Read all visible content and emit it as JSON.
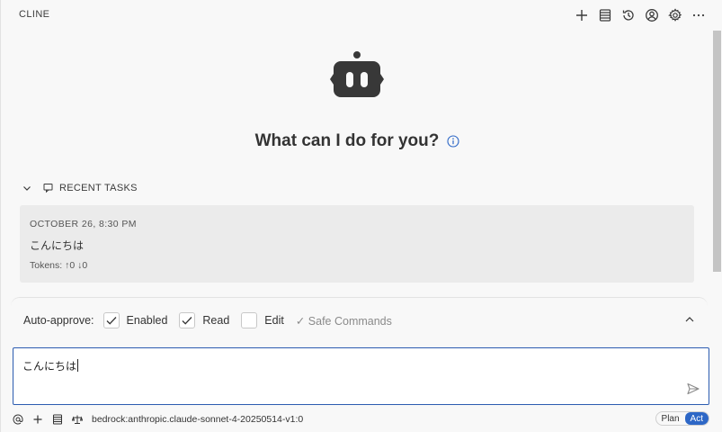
{
  "header": {
    "title": "CLINE",
    "icons": [
      "plus-icon",
      "server-icon",
      "history-icon",
      "account-icon",
      "gear-icon",
      "more-icon"
    ]
  },
  "hero": {
    "title": "What can I do for you?"
  },
  "recent_tasks": {
    "header": "RECENT TASKS",
    "items": [
      {
        "date": "OCTOBER 26, 8:30 PM",
        "text": "こんにちは",
        "tokens": "Tokens: ↑0 ↓0"
      }
    ]
  },
  "auto_approve": {
    "label": "Auto-approve:",
    "options": [
      {
        "label": "Enabled",
        "checked": true
      },
      {
        "label": "Read",
        "checked": true
      },
      {
        "label": "Edit",
        "checked": false
      }
    ],
    "safe_commands": "✓ Safe Commands"
  },
  "chat_input": {
    "value": "こんにちは"
  },
  "footer": {
    "model": "bedrock:anthropic.claude-sonnet-4-20250514-v1:0",
    "modes": [
      "Plan",
      "Act"
    ],
    "active_mode": "Act"
  },
  "colors": {
    "accent": "#2d67c6",
    "input_border": "#2c5cb0",
    "card_bg": "#ebebeb",
    "page_bg": "#f8f8f8"
  }
}
